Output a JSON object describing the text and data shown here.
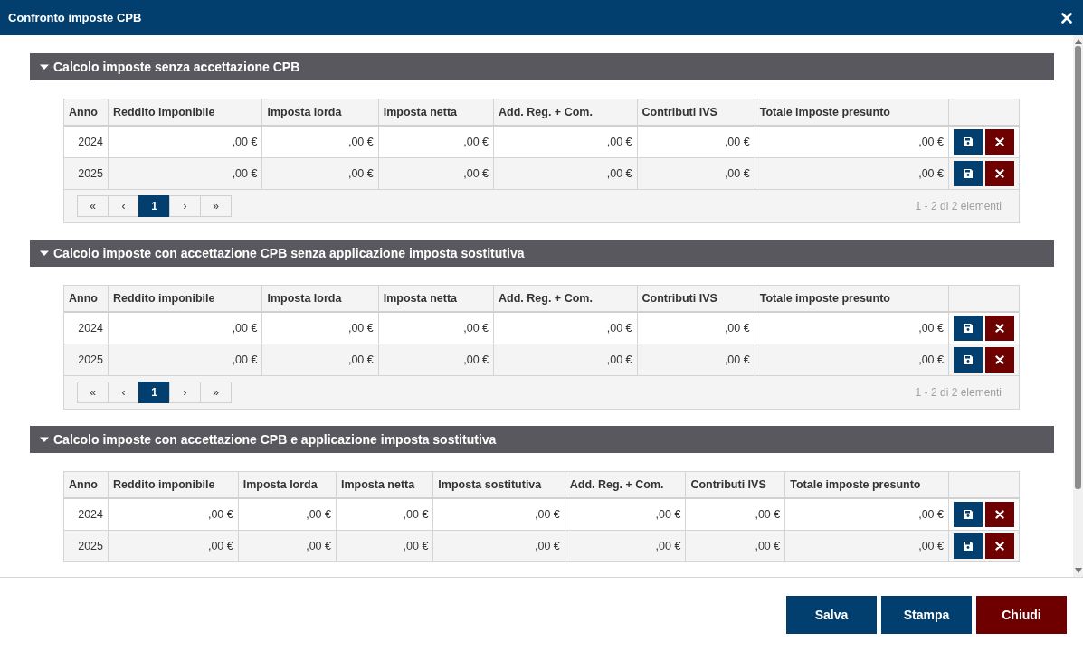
{
  "window": {
    "title": "Confronto imposte CPB"
  },
  "sections": [
    {
      "title": "Calcolo imposte senza accettazione CPB",
      "expanded": true,
      "columns": [
        "Anno",
        "Reddito imponibile",
        "Imposta lorda",
        "Imposta netta",
        "Add. Reg. + Com.",
        "Contributi IVS",
        "Totale imposte presunto"
      ],
      "rows": [
        {
          "cells": [
            "2024",
            ",00 €",
            ",00 €",
            ",00 €",
            ",00 €",
            ",00 €",
            ",00 €"
          ]
        },
        {
          "cells": [
            "2025",
            ",00 €",
            ",00 €",
            ",00 €",
            ",00 €",
            ",00 €",
            ",00 €"
          ]
        }
      ],
      "pager": {
        "first": "«",
        "prev": "‹",
        "pages": [
          {
            "label": "1",
            "selected": true
          }
        ],
        "next": "›",
        "last": "»",
        "summary": "1 - 2 di 2 elementi"
      }
    },
    {
      "title": "Calcolo imposte con accettazione CPB senza applicazione imposta sostitutiva",
      "expanded": true,
      "columns": [
        "Anno",
        "Reddito imponibile",
        "Imposta lorda",
        "Imposta netta",
        "Add. Reg. + Com.",
        "Contributi IVS",
        "Totale imposte presunto"
      ],
      "rows": [
        {
          "cells": [
            "2024",
            ",00 €",
            ",00 €",
            ",00 €",
            ",00 €",
            ",00 €",
            ",00 €"
          ]
        },
        {
          "cells": [
            "2025",
            ",00 €",
            ",00 €",
            ",00 €",
            ",00 €",
            ",00 €",
            ",00 €"
          ]
        }
      ],
      "pager": {
        "first": "«",
        "prev": "‹",
        "pages": [
          {
            "label": "1",
            "selected": true
          }
        ],
        "next": "›",
        "last": "»",
        "summary": "1 - 2 di 2 elementi"
      }
    },
    {
      "title": "Calcolo imposte con accettazione CPB e applicazione imposta sostitutiva",
      "expanded": true,
      "columns": [
        "Anno",
        "Reddito imponibile",
        "Imposta lorda",
        "Imposta netta",
        "Imposta sostitutiva",
        "Add. Reg. + Com.",
        "Contributi IVS",
        "Totale imposte presunto"
      ],
      "rows": [
        {
          "cells": [
            "2024",
            ",00 €",
            ",00 €",
            ",00 €",
            ",00 €",
            ",00 €",
            ",00 €",
            ",00 €"
          ]
        },
        {
          "cells": [
            "2025",
            ",00 €",
            ",00 €",
            ",00 €",
            ",00 €",
            ",00 €",
            ",00 €",
            ",00 €"
          ]
        }
      ]
    }
  ],
  "footer_buttons": [
    {
      "label": "Salva",
      "kind": "primary"
    },
    {
      "label": "Stampa",
      "kind": "primary"
    },
    {
      "label": "Chiudi",
      "kind": "danger"
    }
  ]
}
